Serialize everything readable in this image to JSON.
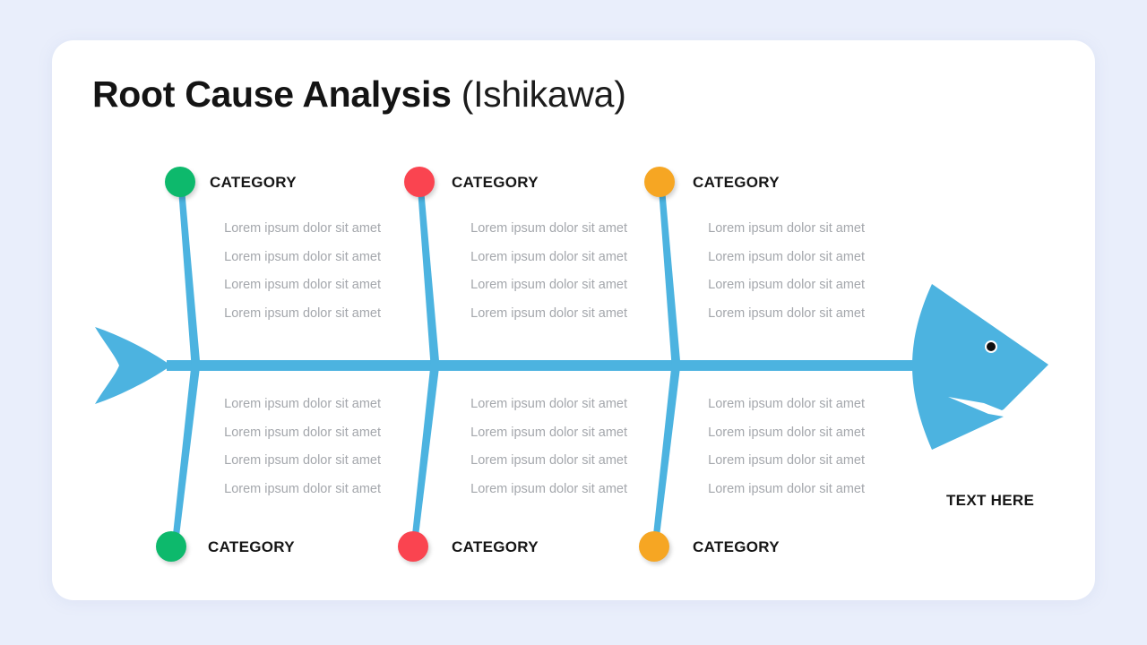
{
  "theme": {
    "page_background": "#e9eefb",
    "card_background": "#ffffff",
    "spine_color": "#4cb3e0",
    "text_muted": "#a4a7ac",
    "text_dark": "#161616"
  },
  "header": {
    "title_strong": "Root Cause Analysis",
    "title_light": "(Ishikawa)"
  },
  "effect": {
    "label": "TEXT HERE"
  },
  "branches": [
    {
      "id": "top-1",
      "side": "top",
      "label": "CATEGORY",
      "color": "#0db96c",
      "causes": [
        "Lorem ipsum dolor sit amet",
        "Lorem ipsum dolor sit amet",
        "Lorem ipsum dolor sit amet",
        "Lorem ipsum dolor sit amet"
      ]
    },
    {
      "id": "top-2",
      "side": "top",
      "label": "CATEGORY",
      "color": "#fa4450",
      "causes": [
        "Lorem ipsum dolor sit amet",
        "Lorem ipsum dolor sit amet",
        "Lorem ipsum dolor sit amet",
        "Lorem ipsum dolor sit amet"
      ]
    },
    {
      "id": "top-3",
      "side": "top",
      "label": "CATEGORY",
      "color": "#f6a623",
      "causes": [
        "Lorem ipsum dolor sit amet",
        "Lorem ipsum dolor sit amet",
        "Lorem ipsum dolor sit amet",
        "Lorem ipsum dolor sit amet"
      ]
    },
    {
      "id": "bottom-1",
      "side": "bottom",
      "label": "CATEGORY",
      "color": "#0db96c",
      "causes": [
        "Lorem ipsum dolor sit amet",
        "Lorem ipsum dolor sit amet",
        "Lorem ipsum dolor sit amet",
        "Lorem ipsum dolor sit amet"
      ]
    },
    {
      "id": "bottom-2",
      "side": "bottom",
      "label": "CATEGORY",
      "color": "#fa4450",
      "causes": [
        "Lorem ipsum dolor sit amet",
        "Lorem ipsum dolor sit amet",
        "Lorem ipsum dolor sit amet",
        "Lorem ipsum dolor sit amet"
      ]
    },
    {
      "id": "bottom-3",
      "side": "bottom",
      "label": "CATEGORY",
      "color": "#f6a623",
      "causes": [
        "Lorem ipsum dolor sit amet",
        "Lorem ipsum dolor sit amet",
        "Lorem ipsum dolor sit amet",
        "Lorem ipsum dolor sit amet"
      ]
    }
  ]
}
